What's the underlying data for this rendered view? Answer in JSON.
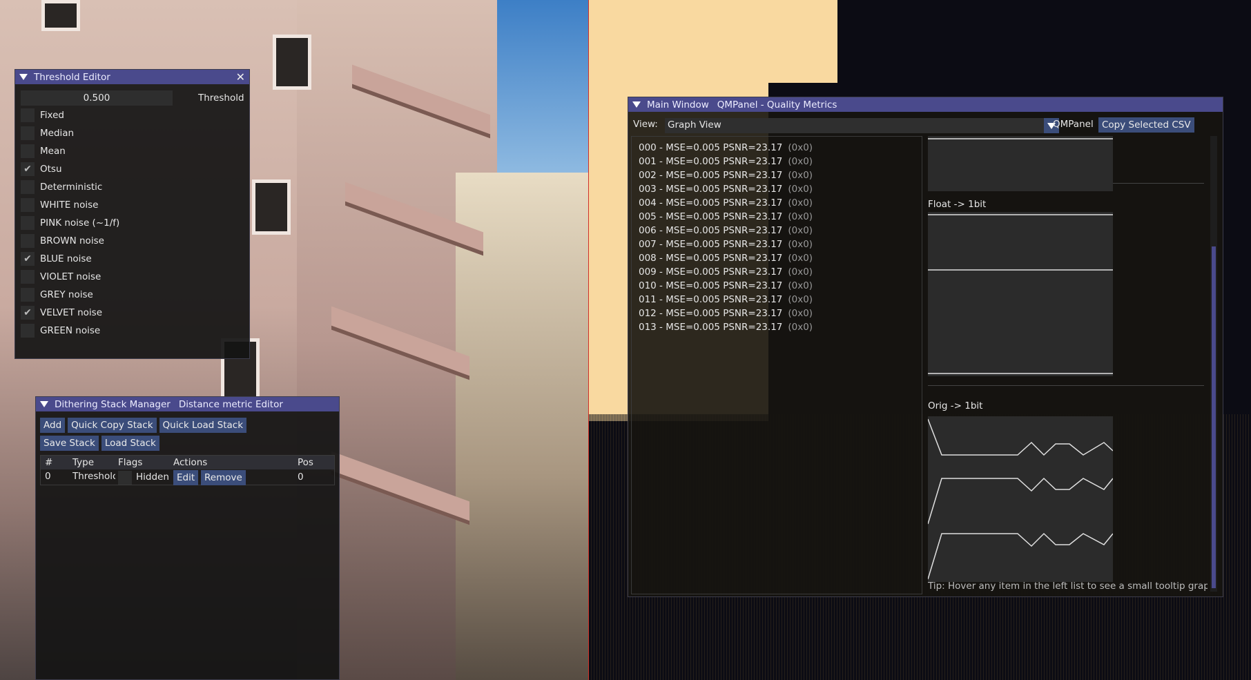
{
  "threshold_editor": {
    "title": "Threshold Editor",
    "threshold_value": "0.500",
    "threshold_label": "Threshold",
    "options": [
      {
        "label": "Fixed",
        "checked": false
      },
      {
        "label": "Median",
        "checked": false
      },
      {
        "label": "Mean",
        "checked": false
      },
      {
        "label": "Otsu",
        "checked": true
      },
      {
        "label": "Deterministic",
        "checked": false
      },
      {
        "label": "WHITE noise",
        "checked": false
      },
      {
        "label": "PINK noise (~1/f)",
        "checked": false
      },
      {
        "label": "BROWN noise",
        "checked": false
      },
      {
        "label": "BLUE noise",
        "checked": true
      },
      {
        "label": "VIOLET noise",
        "checked": false
      },
      {
        "label": "GREY noise",
        "checked": false
      },
      {
        "label": "VELVET noise",
        "checked": true
      },
      {
        "label": "GREEN noise",
        "checked": false
      }
    ]
  },
  "stack_manager": {
    "tab1": "Dithering Stack Manager",
    "tab2": "Distance metric Editor",
    "buttons": [
      "Add",
      "Quick Copy Stack",
      "Quick Load Stack",
      "Save Stack",
      "Load Stack"
    ],
    "columns": [
      "#",
      "Type",
      "Flags",
      "Actions",
      "Pos"
    ],
    "row": {
      "index": "0",
      "type": "Thresholc",
      "flag": "Hidden",
      "edit": "Edit",
      "remove": "Remove",
      "pos": "0"
    }
  },
  "main_window": {
    "tab1": "Main Window",
    "tab2": "QMPanel - Quality Metrics",
    "view_label": "View:",
    "view_value": "Graph View",
    "panel_label": "QMPanel",
    "copy_button": "Copy Selected CSV",
    "items": [
      {
        "text": "000 - MSE=0.005 PSNR=23.17",
        "hex": "(0x0)"
      },
      {
        "text": "001 - MSE=0.005 PSNR=23.17",
        "hex": "(0x0)"
      },
      {
        "text": "002 - MSE=0.005 PSNR=23.17",
        "hex": "(0x0)"
      },
      {
        "text": "003 - MSE=0.005 PSNR=23.17",
        "hex": "(0x0)"
      },
      {
        "text": "004 - MSE=0.005 PSNR=23.17",
        "hex": "(0x0)"
      },
      {
        "text": "005 - MSE=0.005 PSNR=23.17",
        "hex": "(0x0)"
      },
      {
        "text": "006 - MSE=0.005 PSNR=23.17",
        "hex": "(0x0)"
      },
      {
        "text": "007 - MSE=0.005 PSNR=23.17",
        "hex": "(0x0)"
      },
      {
        "text": "008 - MSE=0.005 PSNR=23.17",
        "hex": "(0x0)"
      },
      {
        "text": "009 - MSE=0.005 PSNR=23.17",
        "hex": "(0x0)"
      },
      {
        "text": "010 - MSE=0.005 PSNR=23.17",
        "hex": "(0x0)"
      },
      {
        "text": "011 - MSE=0.005 PSNR=23.17",
        "hex": "(0x0)"
      },
      {
        "text": "012 - MSE=0.005 PSNR=23.17",
        "hex": "(0x0)"
      },
      {
        "text": "013 - MSE=0.005 PSNR=23.17",
        "hex": "(0x0)"
      }
    ],
    "section_float": "Float -> 1bit",
    "section_orig": "Orig -> 1bit",
    "tip": "Tip: Hover any item in the left list to see a small tooltip graph of t"
  }
}
